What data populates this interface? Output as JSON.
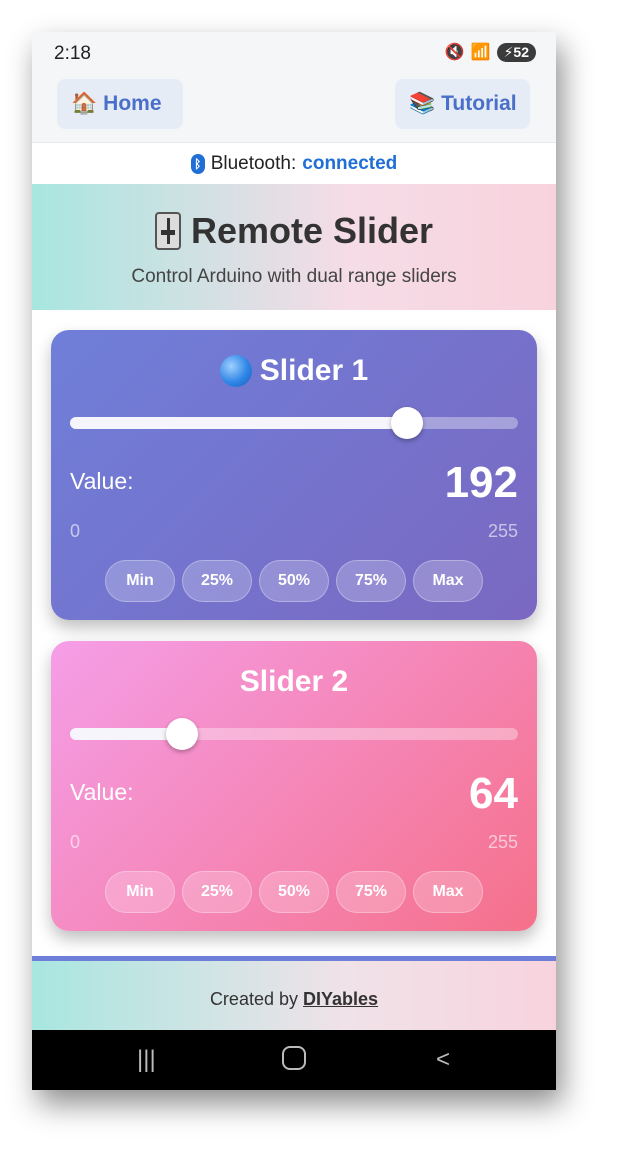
{
  "status_bar": {
    "time": "2:18",
    "battery": "52"
  },
  "nav": {
    "home_label": "Home",
    "tutorial_label": "Tutorial"
  },
  "bluetooth": {
    "label": "Bluetooth:",
    "state": "connected"
  },
  "header": {
    "title": "Remote Slider",
    "subtitle": "Control Arduino with dual range sliders"
  },
  "sliders": [
    {
      "title": "Slider 1",
      "value_label": "Value:",
      "value": "192",
      "min": "0",
      "max": "255",
      "fraction": 0.753,
      "presets": [
        "Min",
        "25%",
        "50%",
        "75%",
        "Max"
      ]
    },
    {
      "title": "Slider 2",
      "value_label": "Value:",
      "value": "64",
      "min": "0",
      "max": "255",
      "fraction": 0.251,
      "presets": [
        "Min",
        "25%",
        "50%",
        "75%",
        "Max"
      ]
    }
  ],
  "footer": {
    "prefix": "Created by",
    "link": "DIYables"
  },
  "colors": {
    "accent": "#4a6fc8",
    "bluetooth": "#1f6fd6",
    "card1": "#7a68c1",
    "card2": "#f5708a"
  }
}
